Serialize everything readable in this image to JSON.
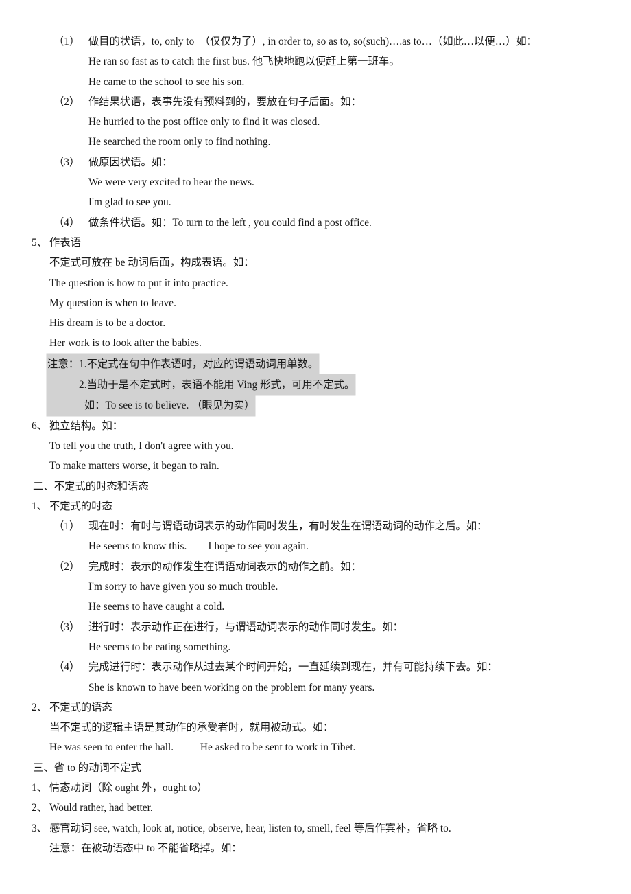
{
  "document": {
    "title": "动词不定式语法讲义",
    "language": "zh-CN/en",
    "highlight_color": "#d2d2d2",
    "text_color": "#1a1a1a",
    "background_color": "#ffffff"
  },
  "blocks": {
    "p1_marker": "（1）",
    "p1_text": "做目的状语，to, only to  （仅仅为了）, in order to, so as to, so(such)….as to…（如此…以便…）如：",
    "p1_ex1": "He ran so fast as to catch the first bus. 他飞快地跑以便赶上第一班车。",
    "p1_ex2": "He came to the school to see his son.",
    "p2_marker": "（2）",
    "p2_text": "作结果状语，表事先没有预料到的，要放在句子后面。如：",
    "p2_ex1": "He hurried to the post office only to find it was closed.",
    "p2_ex2": "He searched the room only to find nothing.",
    "p3_marker": "（3）",
    "p3_text": "做原因状语。如：",
    "p3_ex1": "We were very excited to hear the news.",
    "p3_ex2": "I'm glad to see you.",
    "p4_marker": "（4）",
    "p4_text": "做条件状语。如：To turn to the left , you could find a post office.",
    "s5_marker": "5、",
    "s5_title": "作表语",
    "s5_lead": "不定式可放在 be 动词后面，构成表语。如：",
    "s5_ex1": "The question is how to put it into practice.",
    "s5_ex2": "My question is when to leave.",
    "s5_ex3": "His dream is to be a doctor.",
    "s5_ex4": "Her work is to look after the babies.",
    "s5_note1": "注意：1.不定式在句中作表语时，对应的谓语动词用单数。",
    "s5_note2": "2.当助于是不定式时，表语不能用 Ving 形式，可用不定式。",
    "s5_note3": "如：To see is to believe. （眼见为实）",
    "s6_marker": "6、",
    "s6_title": "独立结构。如：",
    "s6_ex1": "To tell you the truth, I don't agree with you.",
    "s6_ex2": "To make matters worse, it began to rain.",
    "sec2_title": "二、不定式的时态和语态",
    "s2a_marker": "1、",
    "s2a_title": "不定式的时态",
    "t1_marker": "（1）",
    "t1_text": "现在时：有时与谓语动词表示的动作同时发生，有时发生在谓语动词的动作之后。如：",
    "t1_ex1": "He seems to know this.        I hope to see you again.",
    "t2_marker": "（2）",
    "t2_text": "完成时：表示的动作发生在谓语动词表示的动作之前。如：",
    "t2_ex1": "I'm sorry to have given you so much trouble.",
    "t2_ex2": "He seems to have caught a cold.",
    "t3_marker": "（3）",
    "t3_text": "进行时：表示动作正在进行，与谓语动词表示的动作同时发生。如：",
    "t3_ex1": "He seems to be eating something.",
    "t4_marker": "（4）",
    "t4_text": "完成进行时：表示动作从过去某个时间开始，一直延续到现在，并有可能持续下去。如：",
    "t4_ex1": "She is known to have been working on the problem for many years.",
    "s2b_marker": "2、",
    "s2b_title": "不定式的语态",
    "s2b_lead": "当不定式的逻辑主语是其动作的承受者时，就用被动式。如：",
    "s2b_ex1": "He was seen to enter the hall.          He asked to be sent to work in Tibet.",
    "sec3_title": "三、省 to 的动词不定式",
    "s3a_marker": "1、",
    "s3a_text": "情态动词（除 ought 外，ought to）",
    "s3b_marker": "2、",
    "s3b_text": "Would rather, had better.",
    "s3c_marker": "3、",
    "s3c_text": "感官动词 see, watch, look at, notice, observe, hear, listen to, smell, feel 等后作宾补，省略 to.",
    "s3c_note": "注意：在被动语态中 to 不能省略掉。如："
  }
}
